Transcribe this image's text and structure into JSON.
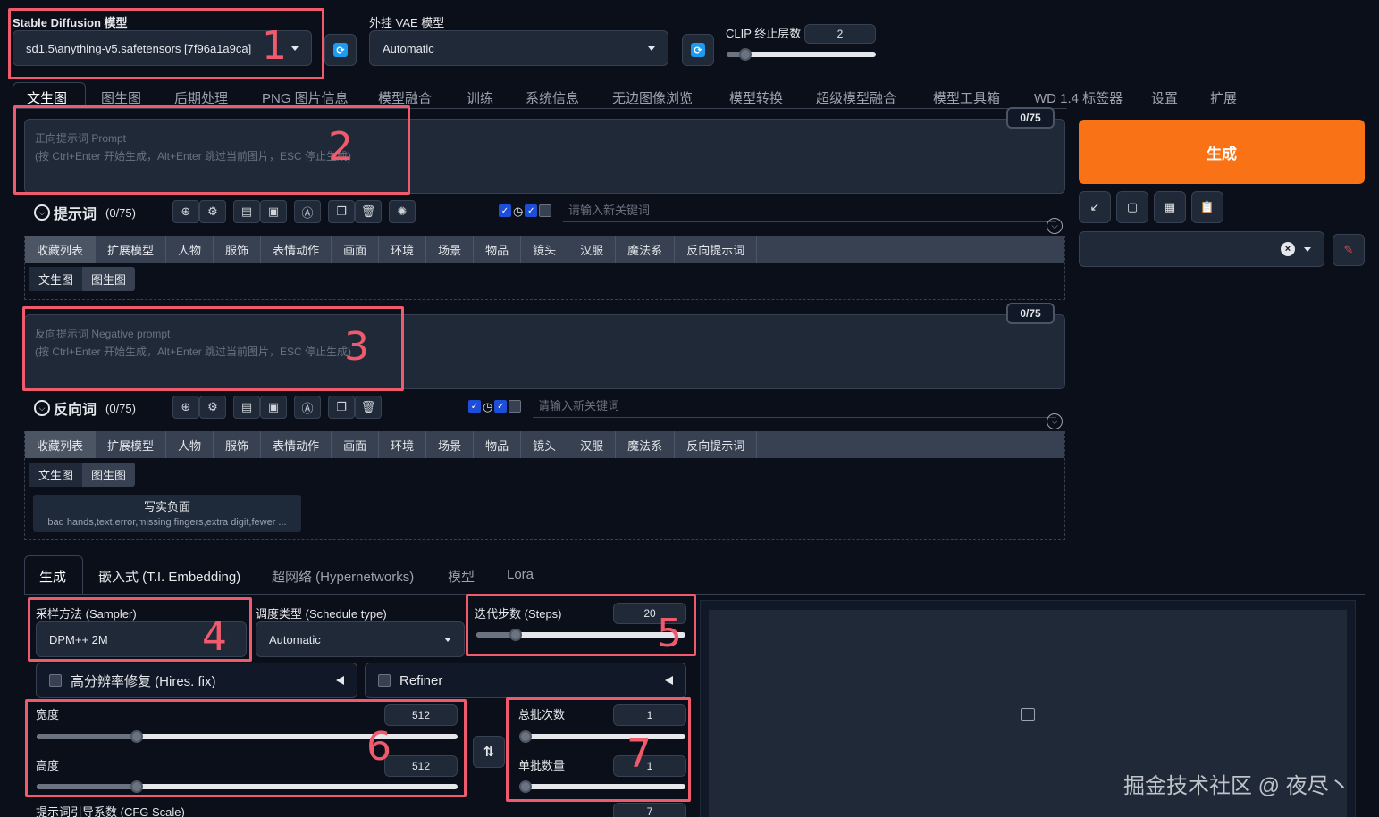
{
  "model": {
    "label": "Stable Diffusion 模型",
    "value": "sd1.5\\anything-v5.safetensors [7f96a1a9ca]"
  },
  "vae": {
    "label": "外挂 VAE 模型",
    "value": "Automatic"
  },
  "clip": {
    "label": "CLIP 终止层数",
    "value": "2"
  },
  "main_tabs": [
    "文生图",
    "图生图",
    "后期处理",
    "PNG 图片信息",
    "模型融合",
    "训练",
    "系统信息",
    "无边图像浏览",
    "模型转换",
    "超级模型融合",
    "模型工具箱",
    "WD 1.4 标签器",
    "设置",
    "扩展"
  ],
  "prompt": {
    "counter": "0/75",
    "placeholder_line1": "正向提示词 Prompt",
    "placeholder_line2": "(按 Ctrl+Enter 开始生成，Alt+Enter 跳过当前图片，ESC 停止生成)",
    "toolbar_title": "提示词",
    "toolbar_count": "(0/75)",
    "keyword_placeholder": "请输入新关键词"
  },
  "negative": {
    "counter": "0/75",
    "placeholder_line1": "反向提示词 Negative prompt",
    "placeholder_line2": "(按 Ctrl+Enter 开始生成，Alt+Enter 跳过当前图片，ESC 停止生成)",
    "toolbar_title": "反向词",
    "toolbar_count": "(0/75)",
    "keyword_placeholder": "请输入新关键词"
  },
  "categories": [
    "收藏列表",
    "扩展模型",
    "人物",
    "服饰",
    "表情动作",
    "画面",
    "环境",
    "场景",
    "物品",
    "镜头",
    "汉服",
    "魔法系",
    "反向提示词"
  ],
  "subtabs": [
    "文生图",
    "图生图"
  ],
  "preset": {
    "title": "写实负面",
    "text": "bad hands,text,error,missing fingers,extra digit,fewer ..."
  },
  "generate_label": "生成",
  "gen_tabs": [
    "生成",
    "嵌入式 (T.I. Embedding)",
    "超网络 (Hypernetworks)",
    "模型",
    "Lora"
  ],
  "sampler": {
    "label": "采样方法 (Sampler)",
    "value": "DPM++ 2M"
  },
  "schedule": {
    "label": "调度类型 (Schedule type)",
    "value": "Automatic"
  },
  "steps": {
    "label": "迭代步数 (Steps)",
    "value": "20",
    "fraction": 0.17
  },
  "hires": {
    "label": "高分辨率修复 (Hires. fix)"
  },
  "refiner": {
    "label": "Refiner"
  },
  "width": {
    "label": "宽度",
    "value": "512",
    "fraction": 0.23
  },
  "height": {
    "label": "高度",
    "value": "512",
    "fraction": 0.23
  },
  "batch_count": {
    "label": "总批次数",
    "value": "1",
    "fraction": 0.0
  },
  "batch_size": {
    "label": "单批数量",
    "value": "1",
    "fraction": 0.0
  },
  "cfg": {
    "label": "提示词引导系数 (CFG Scale)",
    "value": "7"
  },
  "annotations": [
    "1",
    "2",
    "3",
    "4",
    "5",
    "6",
    "7"
  ],
  "watermark": "掘金技术社区 @ 夜尽丶",
  "colors": {
    "generate": "#f97316",
    "highlight": "#ef5b6d",
    "accent": "#1d9bf0"
  }
}
